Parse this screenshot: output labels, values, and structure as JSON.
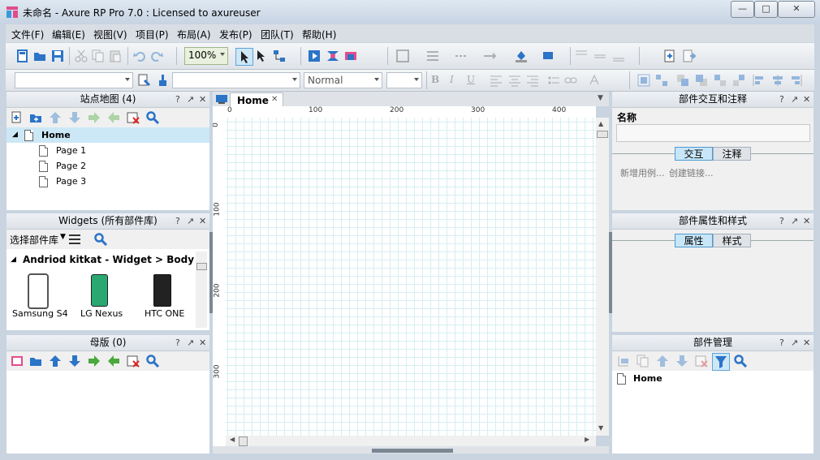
{
  "window": {
    "title": "未命名 - Axure RP Pro 7.0 : Licensed to axureuser",
    "min_symbol": "—",
    "max_symbol": "□",
    "close_symbol": "✕"
  },
  "menu": [
    "文件(F)",
    "编辑(E)",
    "视图(V)",
    "项目(P)",
    "布局(A)",
    "发布(P)",
    "团队(T)",
    "帮助(H)"
  ],
  "toolbar": {
    "zoom": "100%",
    "style_combo": "Normal"
  },
  "sitemap": {
    "title": "站点地图 (4)",
    "root": "Home",
    "pages": [
      "Page 1",
      "Page 2",
      "Page 3"
    ]
  },
  "widgets": {
    "title": "Widgets (所有部件库)",
    "select_library": "选择部件库",
    "category": "Andriod kitkat - Widget > Body",
    "items": [
      "Samsung S4",
      "LG Nexus",
      "HTC ONE"
    ]
  },
  "masters": {
    "title": "母版 (0)"
  },
  "canvas": {
    "tab": "Home",
    "h_ticks": [
      "0",
      "100",
      "200",
      "300",
      "400"
    ],
    "v_ticks": [
      "0",
      "100",
      "200",
      "300"
    ]
  },
  "interactions": {
    "title": "部件交互和注释",
    "name_label": "名称",
    "tab_interaction": "交互",
    "tab_notes": "注释",
    "add_case": "新增用例...",
    "create_link": "创建链接..."
  },
  "properties": {
    "title": "部件属性和样式",
    "tab_props": "属性",
    "tab_style": "样式"
  },
  "manager": {
    "title": "部件管理",
    "root": "Home"
  },
  "panel_controls": {
    "help": "?",
    "popout": "↗",
    "close": "✕"
  },
  "colors": {
    "accent_selected": "#cce8f6",
    "tab_active": "#c7e6f7",
    "grid": "#d6eef2"
  }
}
